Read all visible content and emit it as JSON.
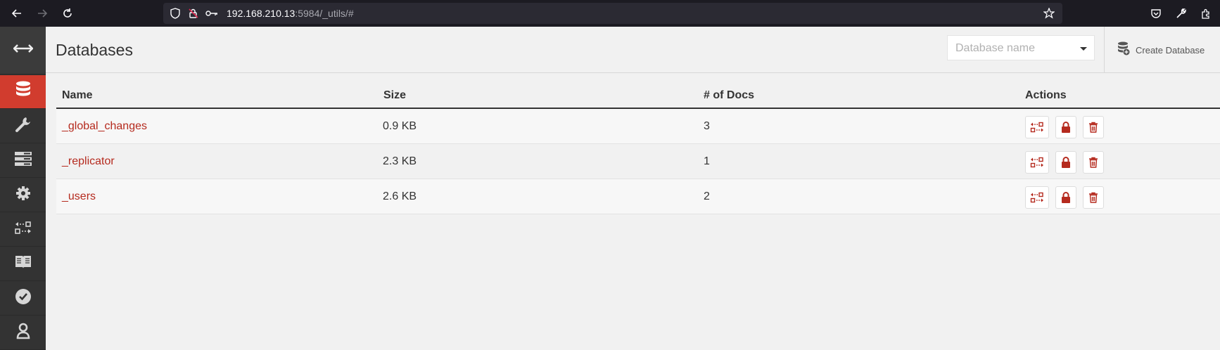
{
  "browser": {
    "url_host": "192.168.210.13",
    "url_rest": ":5984/_utils/#"
  },
  "sidebar": {
    "items": [
      {
        "name": "toggle",
        "icon": "arrows-horizontal-icon"
      },
      {
        "name": "databases",
        "icon": "database-icon",
        "active": true
      },
      {
        "name": "setup",
        "icon": "wrench-icon"
      },
      {
        "name": "active-tasks",
        "icon": "server-icon"
      },
      {
        "name": "config",
        "icon": "gear-icon"
      },
      {
        "name": "replication",
        "icon": "replicate-icon"
      },
      {
        "name": "documentation",
        "icon": "book-icon"
      },
      {
        "name": "verify",
        "icon": "check-circle-icon"
      },
      {
        "name": "user",
        "icon": "user-icon"
      }
    ]
  },
  "header": {
    "title": "Databases",
    "search_placeholder": "Database name",
    "create_label": "Create Database"
  },
  "table": {
    "columns": [
      "Name",
      "Size",
      "# of Docs",
      "Actions"
    ],
    "rows": [
      {
        "name": "_global_changes",
        "size": "0.9 KB",
        "docs": "3"
      },
      {
        "name": "_replicator",
        "size": "2.3 KB",
        "docs": "1"
      },
      {
        "name": "_users",
        "size": "2.6 KB",
        "docs": "2"
      }
    ]
  },
  "colors": {
    "accent": "#d13c2e",
    "link": "#b52a1e",
    "sidebar": "#333333"
  }
}
